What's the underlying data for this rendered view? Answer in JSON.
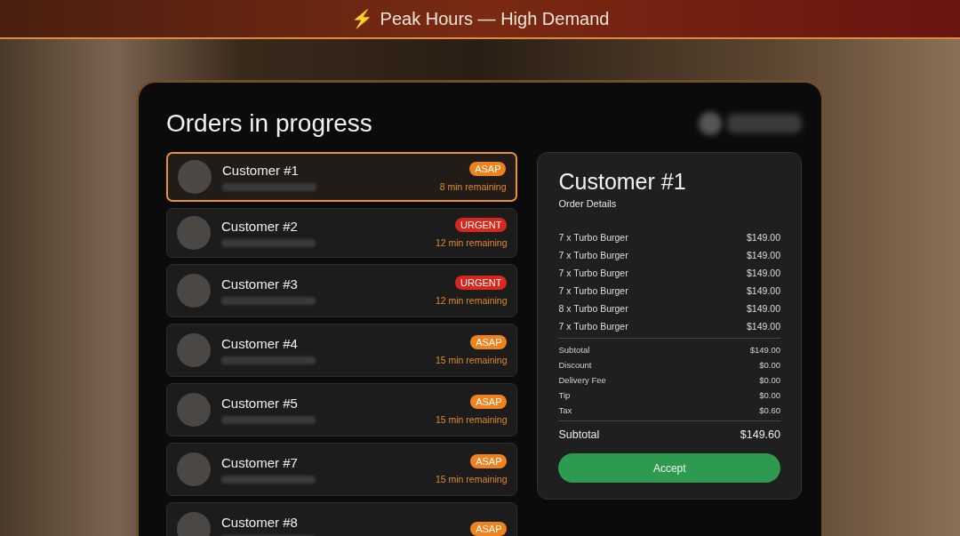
{
  "banner": {
    "icon": "⚡",
    "text": "Peak Hours — High Demand"
  },
  "header": {
    "title": "Orders in progress"
  },
  "orders": [
    {
      "name": "Customer #1",
      "badge": "ASAP",
      "kind": "asap",
      "remaining": "8 min remaining",
      "selected": true
    },
    {
      "name": "Customer #2",
      "badge": "URGENT",
      "kind": "urgent",
      "remaining": "12 min remaining",
      "selected": false
    },
    {
      "name": "Customer #3",
      "badge": "URGENT",
      "kind": "urgent",
      "remaining": "12 min remaining",
      "selected": false
    },
    {
      "name": "Customer #4",
      "badge": "ASAP",
      "kind": "asap",
      "remaining": "15 min remaining",
      "selected": false
    },
    {
      "name": "Customer #5",
      "badge": "ASAP",
      "kind": "asap",
      "remaining": "15 min remaining",
      "selected": false
    },
    {
      "name": "Customer #7",
      "badge": "ASAP",
      "kind": "asap",
      "remaining": "15 min remaining",
      "selected": false
    },
    {
      "name": "Customer #8",
      "badge": "ASAP",
      "kind": "asap",
      "selected": false
    }
  ],
  "detail": {
    "title": "Customer #1",
    "subtitle": "Order Details",
    "items": [
      {
        "label": "7 x Turbo Burger",
        "price": "$149.00"
      },
      {
        "label": "7 x Turbo Burger",
        "price": "$149.00"
      },
      {
        "label": "7 x Turbo Burger",
        "price": "$149.00"
      },
      {
        "label": "7 x Turbo Burger",
        "price": "$149.00"
      },
      {
        "label": "8 x Turbo Burger",
        "price": "$149.00"
      },
      {
        "label": "7 x Turbo Burger",
        "price": "$149.00"
      }
    ],
    "summary": [
      {
        "label": "Subtotal",
        "value": "$149.00"
      },
      {
        "label": "Discount",
        "value": "$0.00"
      },
      {
        "label": "Delivery Fee",
        "value": "$0.00"
      },
      {
        "label": "Tip",
        "value": "$0.00"
      },
      {
        "label": "Tax",
        "value": "$0.60"
      }
    ],
    "total": {
      "label": "Subtotal",
      "value": "$149.60"
    },
    "button": "Accept"
  }
}
